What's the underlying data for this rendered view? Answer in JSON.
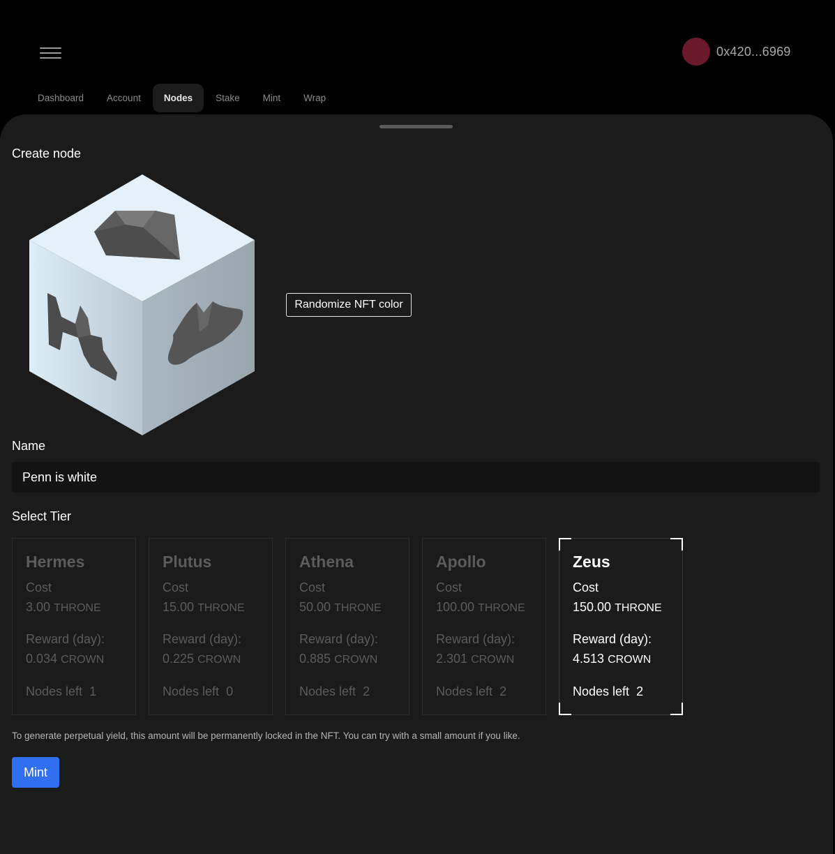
{
  "header": {
    "wallet_address": "0x420...6969",
    "avatar_color": "#6b1a2e"
  },
  "tabs": [
    {
      "label": "Dashboard",
      "active": false
    },
    {
      "label": "Account",
      "active": false
    },
    {
      "label": "Nodes",
      "active": true
    },
    {
      "label": "Stake",
      "active": false
    },
    {
      "label": "Mint",
      "active": false
    },
    {
      "label": "Wrap",
      "active": false
    }
  ],
  "create_node": {
    "title": "Create node",
    "randomize_label": "Randomize NFT color",
    "nft_color": "#e4f1fb",
    "name_label": "Name",
    "name_value": "Penn is white",
    "select_tier_label": "Select Tier",
    "cost_label": "Cost",
    "reward_label": "Reward (day):",
    "nodes_left_label": "Nodes left",
    "cost_unit": "THRONE",
    "reward_unit": "CROWN",
    "tiers": [
      {
        "name": "Hermes",
        "cost": "3.00",
        "reward": "0.034",
        "nodes_left": "1",
        "selected": false
      },
      {
        "name": "Plutus",
        "cost": "15.00",
        "reward": "0.225",
        "nodes_left": "0",
        "selected": false
      },
      {
        "name": "Athena",
        "cost": "50.00",
        "reward": "0.885",
        "nodes_left": "2",
        "selected": false
      },
      {
        "name": "Apollo",
        "cost": "100.00",
        "reward": "2.301",
        "nodes_left": "2",
        "selected": false
      },
      {
        "name": "Zeus",
        "cost": "150.00",
        "reward": "4.513",
        "nodes_left": "2",
        "selected": true
      }
    ],
    "note": "To generate perpetual yield, this amount will be permanently locked in the NFT. You can try with a small amount if you like.",
    "mint_label": "Mint",
    "mint_color": "#2f6ff0"
  }
}
